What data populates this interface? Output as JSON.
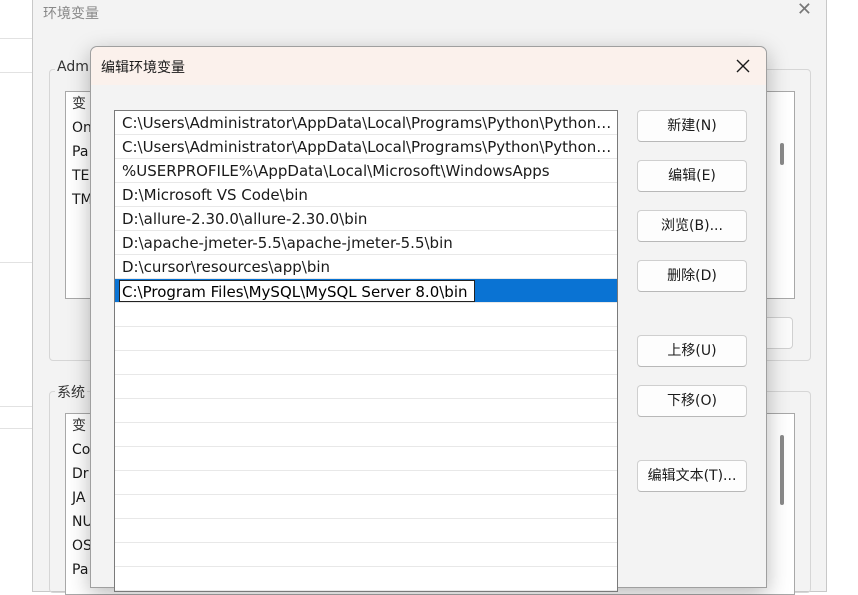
{
  "background_window": {
    "title": "环境变量",
    "user_section_label": "Adm",
    "user_list_header": "变",
    "user_rows": [
      "On",
      "Pa",
      "TE",
      "TM"
    ],
    "system_section_label": "系统",
    "system_list_header": "变",
    "system_rows": [
      "Co",
      "Dr",
      "JA",
      "NU",
      "OS",
      "Pa"
    ]
  },
  "dialog": {
    "title": "编辑环境变量",
    "paths": [
      "C:\\Users\\Administrator\\AppData\\Local\\Programs\\Python\\Python3...",
      "C:\\Users\\Administrator\\AppData\\Local\\Programs\\Python\\Python3...",
      "%USERPROFILE%\\AppData\\Local\\Microsoft\\WindowsApps",
      "D:\\Microsoft VS Code\\bin",
      "D:\\allure-2.30.0\\allure-2.30.0\\bin",
      "D:\\apache-jmeter-5.5\\apache-jmeter-5.5\\bin",
      "D:\\cursor\\resources\\app\\bin"
    ],
    "editing_value": "C:\\Program Files\\MySQL\\MySQL Server 8.0\\bin",
    "buttons": {
      "new": "新建(N)",
      "edit": "编辑(E)",
      "browse": "浏览(B)...",
      "delete": "删除(D)",
      "move_up": "上移(U)",
      "move_down": "下移(O)",
      "edit_text": "编辑文本(T)..."
    }
  },
  "colors": {
    "selection": "#0a73d3",
    "title_bar": "#fbf1ec",
    "dialog_bg": "#f3f3f3"
  }
}
